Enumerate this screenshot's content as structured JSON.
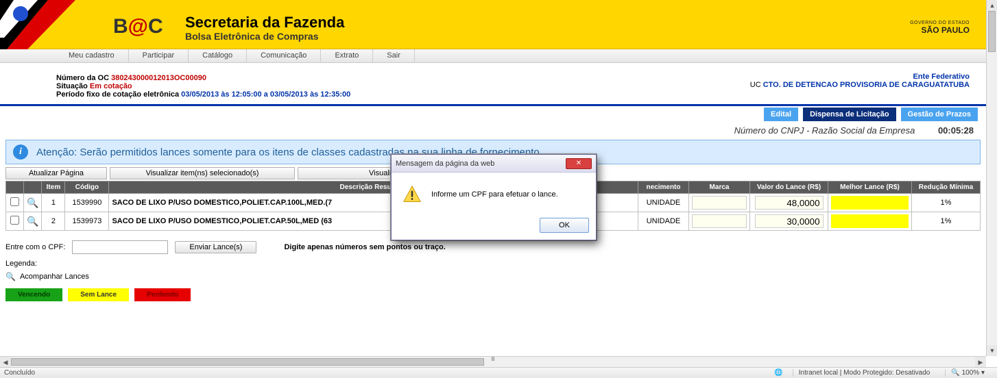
{
  "header": {
    "bec_label": "B",
    "bec_at": "@",
    "bec_c": "C",
    "title": "Secretaria da Fazenda",
    "subtitle": "Bolsa Eletrônica de Compras",
    "gov_top": "GOVERNO DO ESTADO",
    "gov_sp": "SÃO PAULO"
  },
  "menu": [
    "Meu cadastro",
    "Participar",
    "Catálogo",
    "Comunicação",
    "Extrato",
    "Sair"
  ],
  "info": {
    "l1_label": "Número da OC ",
    "l1_val": "380243000012013OC00090",
    "l2_label": "Situação ",
    "l2_val": "Em cotação",
    "l3_label": "Período fixo de cotação eletrônica  ",
    "l3_val": "03/05/2013 às 12:05:00 a 03/05/2013 às 12:35:00",
    "ente_label": "Ente Federativo",
    "uc_prefix": "UC ",
    "uc_val": "CTO. DE DETENCAO PROVISORIA DE CARAGUATATUBA"
  },
  "btns": {
    "edital": "Edital",
    "dispensa": "Dispensa de Licitação",
    "gestao": "Gestão de Prazos"
  },
  "cnpj": {
    "text": "Número do CNPJ - Razão Social da Empresa",
    "timer": "00:05:28"
  },
  "alert": "Atenção: Serão permitidos lances somente para os itens de classes cadastradas na sua linha de fornecimento.",
  "actions": {
    "atualizar": "Atualizar Página",
    "visualizar_sel": "Visualizar item(ns) selecionado(s)",
    "visualizar_tod": "Visualizar To"
  },
  "columns": [
    "",
    "",
    "Item",
    "Código",
    "Descrição Resumida",
    "necimento",
    "Marca",
    "Valor do Lance (R$)",
    "Melhor Lance (R$)",
    "Redução Mínima"
  ],
  "rows": [
    {
      "item": "1",
      "codigo": "1539990",
      "desc": "SACO DE LIXO P/USO DOMESTICO,POLIET.CAP.100L,MED.(7",
      "forn": "UNIDADE",
      "valor": "48,0000",
      "red": "1%"
    },
    {
      "item": "2",
      "codigo": "1539973",
      "desc": "SACO DE LIXO P/USO DOMESTICO,POLIET.CAP.50L,MED (63",
      "forn": "UNIDADE",
      "valor": "30,0000",
      "red": "1%"
    }
  ],
  "cpf": {
    "label": "Entre com o CPF:",
    "button": "Enviar Lance(s)",
    "hint": "Digite apenas números sem pontos ou traço."
  },
  "legenda": {
    "title": "Legenda:",
    "acompanhar": "Acompanhar Lances",
    "vencendo": "Vencendo",
    "sem": "Sem Lance",
    "perdendo": "Perdendo"
  },
  "dialog": {
    "title": "Mensagem da página da web",
    "close": "✕",
    "message": "Informe um CPF para efetuar o lance.",
    "ok": "OK"
  },
  "status": {
    "left": "Concluído",
    "zone": "Intranet local | Modo Protegido: Desativado",
    "zoom": "100%"
  }
}
